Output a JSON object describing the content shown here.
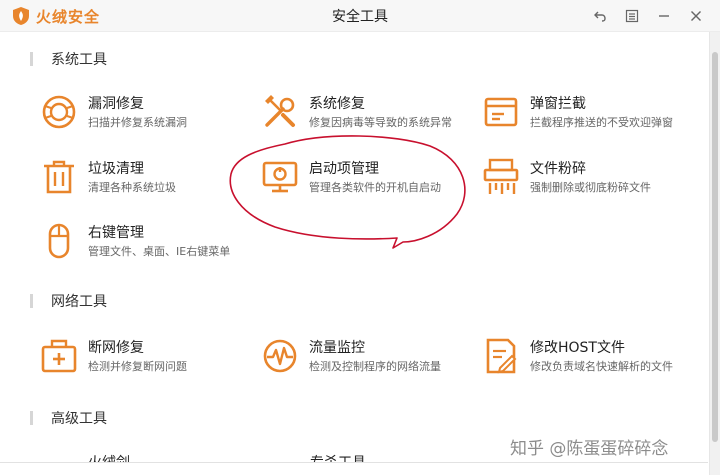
{
  "app": {
    "brand": "火绒安全",
    "window_title": "安全工具"
  },
  "colors": {
    "accent": "#e8852c",
    "annotation": "#c8102e"
  },
  "window_controls": [
    {
      "name": "back-icon"
    },
    {
      "name": "menu-icon"
    },
    {
      "name": "minimize-icon"
    },
    {
      "name": "close-icon"
    }
  ],
  "sections": {
    "system": "系统工具",
    "network": "网络工具",
    "advanced": "高级工具"
  },
  "system_tools": [
    {
      "name": "漏洞修复",
      "desc": "扫描并修复系统漏洞",
      "icon": "vuln-fix-icon"
    },
    {
      "name": "系统修复",
      "desc": "修复因病毒等导致的系统异常",
      "icon": "wrench-icon"
    },
    {
      "name": "弹窗拦截",
      "desc": "拦截程序推送的不受欢迎弹窗",
      "icon": "popup-block-icon"
    },
    {
      "name": "垃圾清理",
      "desc": "清理各种系统垃圾",
      "icon": "trash-icon"
    },
    {
      "name": "启动项管理",
      "desc": "管理各类软件的开机自启动",
      "icon": "monitor-icon"
    },
    {
      "name": "文件粉碎",
      "desc": "强制删除或彻底粉碎文件",
      "icon": "shredder-icon"
    },
    {
      "name": "右键管理",
      "desc": "管理文件、桌面、IE右键菜单",
      "icon": "mouse-icon"
    }
  ],
  "network_tools": [
    {
      "name": "断网修复",
      "desc": "检测并修复断网问题",
      "icon": "network-repair-icon"
    },
    {
      "name": "流量监控",
      "desc": "检测及控制程序的网络流量",
      "icon": "traffic-monitor-icon"
    },
    {
      "name": "修改HOST文件",
      "desc": "修改负责域名快速解析的文件",
      "icon": "host-file-icon"
    }
  ],
  "advanced_partial": {
    "tool_a": "火绒剑",
    "tool_b": "专杀工具"
  },
  "watermark": "知乎 @陈蛋蛋碎碎念"
}
